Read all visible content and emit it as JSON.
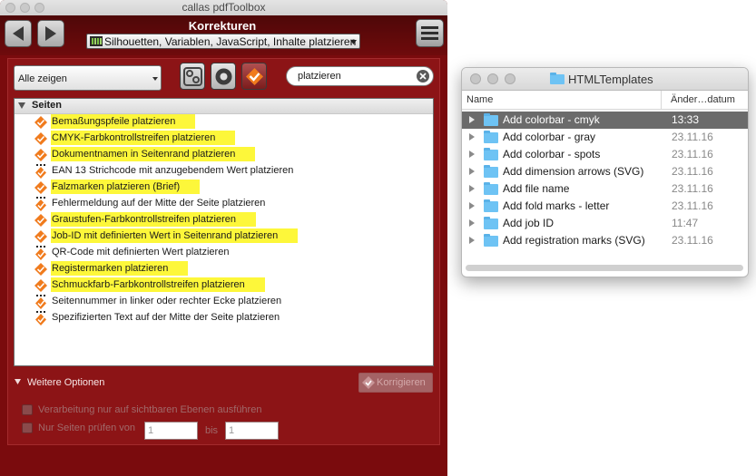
{
  "window": {
    "title": "callas pdfToolbox"
  },
  "toolbar": {
    "title": "Korrekturen",
    "profile_label": "Silhouetten, Variablen, JavaScript, Inhalte platzieren"
  },
  "filter": {
    "selected": "Alle zeigen"
  },
  "search": {
    "value": "platzieren"
  },
  "list": {
    "group": "Seiten",
    "items": [
      {
        "label": "Bemaßungspfeile platzieren",
        "highlight": true,
        "icon": "fixup-icon"
      },
      {
        "label": "CMYK-Farbkontrollstreifen platzieren",
        "highlight": true,
        "icon": "fixup-icon"
      },
      {
        "label": "Dokumentnamen in Seitenrand platzieren",
        "highlight": true,
        "icon": "fixup-icon"
      },
      {
        "label": "EAN 13 Strichcode mit anzugebendem Wert platzieren",
        "highlight": false,
        "icon": "fixup-variable-icon"
      },
      {
        "label": "Falzmarken platzieren (Brief)",
        "highlight": true,
        "icon": "fixup-icon"
      },
      {
        "label": "Fehlermeldung auf der Mitte der Seite platzieren",
        "highlight": false,
        "icon": "fixup-variable-icon"
      },
      {
        "label": "Graustufen-Farbkontrollstreifen platzieren",
        "highlight": true,
        "icon": "fixup-icon"
      },
      {
        "label": "Job-ID mit definierten Wert in Seitenrand platzieren",
        "highlight": true,
        "icon": "fixup-icon"
      },
      {
        "label": "QR-Code mit definierten Wert platzieren",
        "highlight": false,
        "icon": "fixup-variable-icon"
      },
      {
        "label": "Registermarken platzieren",
        "highlight": true,
        "icon": "fixup-icon"
      },
      {
        "label": "Schmuckfarb-Farbkontrollstreifen platzieren",
        "highlight": true,
        "icon": "fixup-icon"
      },
      {
        "label": "Seitennummer in linker oder rechter Ecke platzieren",
        "highlight": false,
        "icon": "fixup-variable-icon"
      },
      {
        "label": "Spezifizierten Text auf der Mitte der Seite platzieren",
        "highlight": false,
        "icon": "fixup-variable-icon"
      }
    ]
  },
  "options": {
    "header": "Weitere Optionen",
    "fix_button": "Korrigieren",
    "visible_layers_label": "Verarbeitung nur auf sichtbaren Ebenen ausführen",
    "pages_label": "Nur Seiten prüfen von",
    "from_placeholder": "1",
    "to_label": "bis",
    "to_placeholder": "1"
  },
  "finder": {
    "title": "HTMLTemplates",
    "col_name": "Name",
    "col_date": "Änder…datum",
    "rows": [
      {
        "name": "Add colorbar - cmyk",
        "date": "13:33",
        "selected": true
      },
      {
        "name": "Add colorbar - gray",
        "date": "23.11.16",
        "selected": false
      },
      {
        "name": "Add colorbar - spots",
        "date": "23.11.16",
        "selected": false
      },
      {
        "name": "Add dimension arrows (SVG)",
        "date": "23.11.16",
        "selected": false
      },
      {
        "name": "Add file name",
        "date": "23.11.16",
        "selected": false
      },
      {
        "name": "Add fold marks - letter",
        "date": "23.11.16",
        "selected": false
      },
      {
        "name": "Add job ID",
        "date": "11:47",
        "selected": false
      },
      {
        "name": "Add registration marks (SVG)",
        "date": "23.11.16",
        "selected": false
      }
    ]
  },
  "colors": {
    "window_bg": "#7a0b0d",
    "highlight": "#fdf73a",
    "fixup_orange": "#f07b1d",
    "finder_selected": "#6b6b6b",
    "folder_blue": "#6ec3f4"
  }
}
